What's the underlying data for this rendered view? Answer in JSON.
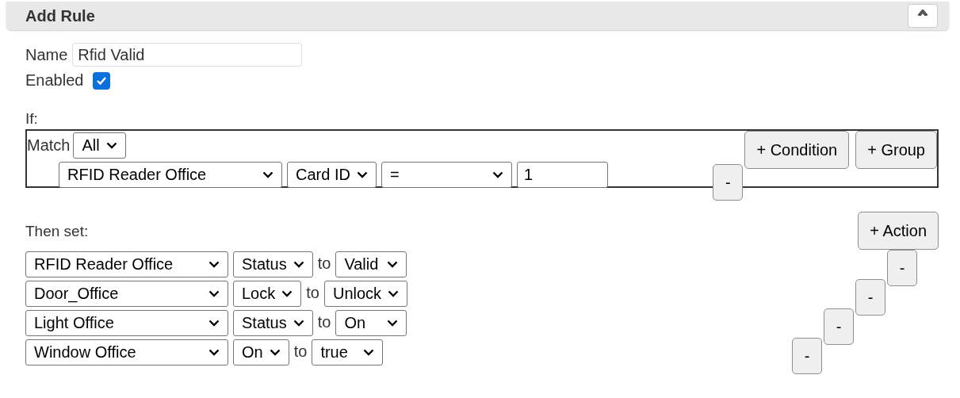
{
  "dialog": {
    "title": "Add Rule"
  },
  "name_field": {
    "label": "Name",
    "value": "Rfid Valid"
  },
  "enabled": {
    "label": "Enabled",
    "checked": true
  },
  "if_label": "If:",
  "match": {
    "label": "Match",
    "value": "All"
  },
  "conditions": [
    {
      "device": "RFID Reader Office",
      "property": "Card ID",
      "operator": "=",
      "value": "1",
      "remove": "-"
    }
  ],
  "condition_buttons": [
    "+ Condition",
    "+ Group"
  ],
  "then_label": "Then set:",
  "add_action": "+ Action",
  "actions": [
    {
      "device": "RFID Reader Office",
      "property": "Status",
      "connector": "to",
      "value": "Valid",
      "remove": "-"
    },
    {
      "device": "Door_Office",
      "property": "Lock",
      "connector": "to",
      "value": "Unlock",
      "remove": "-"
    },
    {
      "device": "Light Office",
      "property": "Status",
      "connector": "to",
      "value": "On",
      "remove": "-"
    },
    {
      "device": "Window Office",
      "property": "On",
      "connector": "to",
      "value": "true",
      "remove": "-"
    }
  ]
}
